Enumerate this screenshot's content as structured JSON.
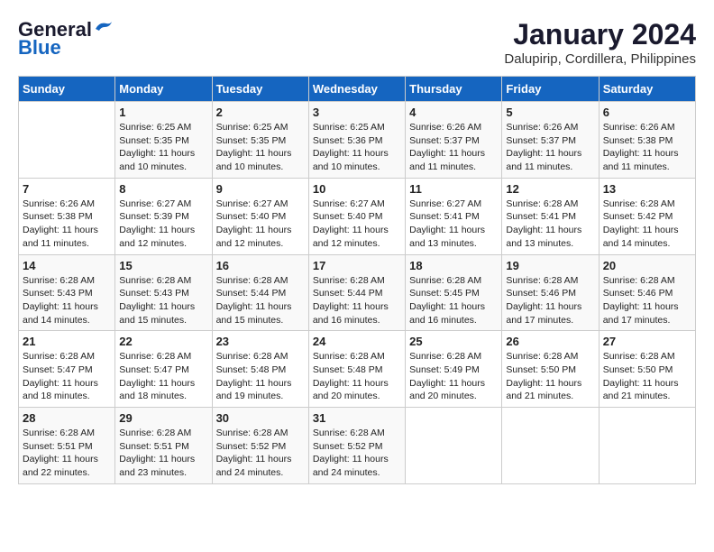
{
  "header": {
    "logo_line1": "General",
    "logo_line2": "Blue",
    "title": "January 2024",
    "subtitle": "Dalupirip, Cordillera, Philippines"
  },
  "days_of_week": [
    "Sunday",
    "Monday",
    "Tuesday",
    "Wednesday",
    "Thursday",
    "Friday",
    "Saturday"
  ],
  "weeks": [
    [
      {
        "day": "",
        "content": ""
      },
      {
        "day": "1",
        "content": "Sunrise: 6:25 AM\nSunset: 5:35 PM\nDaylight: 11 hours\nand 10 minutes."
      },
      {
        "day": "2",
        "content": "Sunrise: 6:25 AM\nSunset: 5:35 PM\nDaylight: 11 hours\nand 10 minutes."
      },
      {
        "day": "3",
        "content": "Sunrise: 6:25 AM\nSunset: 5:36 PM\nDaylight: 11 hours\nand 10 minutes."
      },
      {
        "day": "4",
        "content": "Sunrise: 6:26 AM\nSunset: 5:37 PM\nDaylight: 11 hours\nand 11 minutes."
      },
      {
        "day": "5",
        "content": "Sunrise: 6:26 AM\nSunset: 5:37 PM\nDaylight: 11 hours\nand 11 minutes."
      },
      {
        "day": "6",
        "content": "Sunrise: 6:26 AM\nSunset: 5:38 PM\nDaylight: 11 hours\nand 11 minutes."
      }
    ],
    [
      {
        "day": "7",
        "content": "Sunrise: 6:26 AM\nSunset: 5:38 PM\nDaylight: 11 hours\nand 11 minutes."
      },
      {
        "day": "8",
        "content": "Sunrise: 6:27 AM\nSunset: 5:39 PM\nDaylight: 11 hours\nand 12 minutes."
      },
      {
        "day": "9",
        "content": "Sunrise: 6:27 AM\nSunset: 5:40 PM\nDaylight: 11 hours\nand 12 minutes."
      },
      {
        "day": "10",
        "content": "Sunrise: 6:27 AM\nSunset: 5:40 PM\nDaylight: 11 hours\nand 12 minutes."
      },
      {
        "day": "11",
        "content": "Sunrise: 6:27 AM\nSunset: 5:41 PM\nDaylight: 11 hours\nand 13 minutes."
      },
      {
        "day": "12",
        "content": "Sunrise: 6:28 AM\nSunset: 5:41 PM\nDaylight: 11 hours\nand 13 minutes."
      },
      {
        "day": "13",
        "content": "Sunrise: 6:28 AM\nSunset: 5:42 PM\nDaylight: 11 hours\nand 14 minutes."
      }
    ],
    [
      {
        "day": "14",
        "content": "Sunrise: 6:28 AM\nSunset: 5:43 PM\nDaylight: 11 hours\nand 14 minutes."
      },
      {
        "day": "15",
        "content": "Sunrise: 6:28 AM\nSunset: 5:43 PM\nDaylight: 11 hours\nand 15 minutes."
      },
      {
        "day": "16",
        "content": "Sunrise: 6:28 AM\nSunset: 5:44 PM\nDaylight: 11 hours\nand 15 minutes."
      },
      {
        "day": "17",
        "content": "Sunrise: 6:28 AM\nSunset: 5:44 PM\nDaylight: 11 hours\nand 16 minutes."
      },
      {
        "day": "18",
        "content": "Sunrise: 6:28 AM\nSunset: 5:45 PM\nDaylight: 11 hours\nand 16 minutes."
      },
      {
        "day": "19",
        "content": "Sunrise: 6:28 AM\nSunset: 5:46 PM\nDaylight: 11 hours\nand 17 minutes."
      },
      {
        "day": "20",
        "content": "Sunrise: 6:28 AM\nSunset: 5:46 PM\nDaylight: 11 hours\nand 17 minutes."
      }
    ],
    [
      {
        "day": "21",
        "content": "Sunrise: 6:28 AM\nSunset: 5:47 PM\nDaylight: 11 hours\nand 18 minutes."
      },
      {
        "day": "22",
        "content": "Sunrise: 6:28 AM\nSunset: 5:47 PM\nDaylight: 11 hours\nand 18 minutes."
      },
      {
        "day": "23",
        "content": "Sunrise: 6:28 AM\nSunset: 5:48 PM\nDaylight: 11 hours\nand 19 minutes."
      },
      {
        "day": "24",
        "content": "Sunrise: 6:28 AM\nSunset: 5:48 PM\nDaylight: 11 hours\nand 20 minutes."
      },
      {
        "day": "25",
        "content": "Sunrise: 6:28 AM\nSunset: 5:49 PM\nDaylight: 11 hours\nand 20 minutes."
      },
      {
        "day": "26",
        "content": "Sunrise: 6:28 AM\nSunset: 5:50 PM\nDaylight: 11 hours\nand 21 minutes."
      },
      {
        "day": "27",
        "content": "Sunrise: 6:28 AM\nSunset: 5:50 PM\nDaylight: 11 hours\nand 21 minutes."
      }
    ],
    [
      {
        "day": "28",
        "content": "Sunrise: 6:28 AM\nSunset: 5:51 PM\nDaylight: 11 hours\nand 22 minutes."
      },
      {
        "day": "29",
        "content": "Sunrise: 6:28 AM\nSunset: 5:51 PM\nDaylight: 11 hours\nand 23 minutes."
      },
      {
        "day": "30",
        "content": "Sunrise: 6:28 AM\nSunset: 5:52 PM\nDaylight: 11 hours\nand 24 minutes."
      },
      {
        "day": "31",
        "content": "Sunrise: 6:28 AM\nSunset: 5:52 PM\nDaylight: 11 hours\nand 24 minutes."
      },
      {
        "day": "",
        "content": ""
      },
      {
        "day": "",
        "content": ""
      },
      {
        "day": "",
        "content": ""
      }
    ]
  ]
}
